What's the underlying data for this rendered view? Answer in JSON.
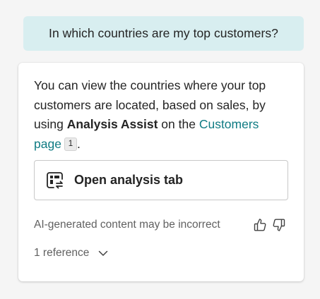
{
  "user_message": {
    "text": "In which countries are my top customers?"
  },
  "response": {
    "text_part1": "You can view the countries where your top customers are located, based on sales, by using ",
    "bold_text": "Analysis Assist",
    "text_part2": " on the ",
    "link_text": "Customers page",
    "citation_number": "1",
    "text_end": ".",
    "open_button_label": "Open analysis tab",
    "open_button_icon": "open-analysis-tab-icon",
    "disclaimer": "AI-generated content may be incorrect",
    "references_label": "1 reference"
  },
  "colors": {
    "user_bubble_bg": "#d8eef0",
    "link": "#0f7b83",
    "muted_text": "#616161"
  }
}
